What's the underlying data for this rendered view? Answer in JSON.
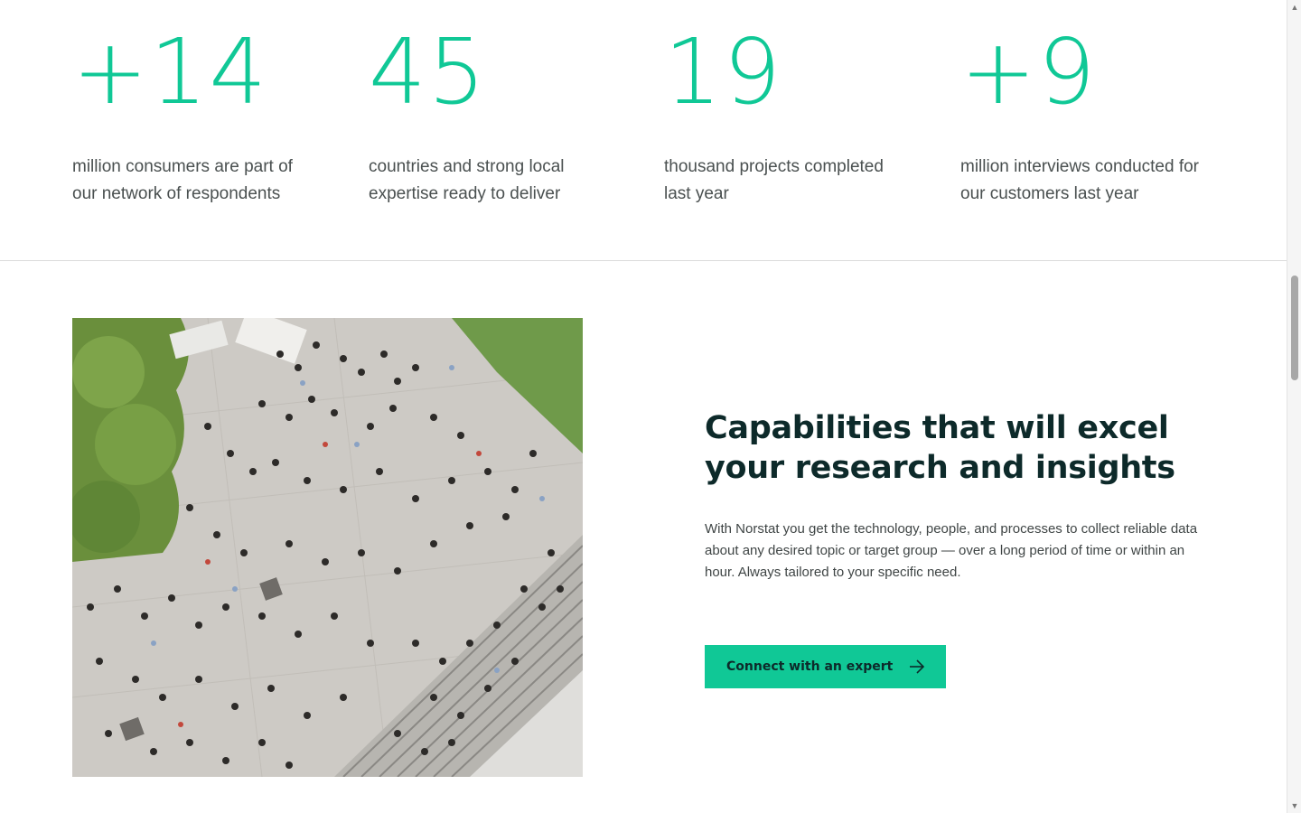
{
  "stats": [
    {
      "number": "+14",
      "text": "million consumers are part of our network of respondents"
    },
    {
      "number": "45",
      "text": "countries and strong local expertise ready to deliver"
    },
    {
      "number": "19",
      "text": "thousand projects completed last year"
    },
    {
      "number": "+9",
      "text": "million interviews conducted for our customers last year"
    }
  ],
  "capabilities": {
    "title": "Capabilities that will excel your research and insights",
    "body": "With Norstat you get the technology, people, and processes to collect reliable data about any desired topic or target group — over a long period of time or within an hour. Always tailored to your specific need.",
    "cta_label": "Connect with an expert"
  },
  "icons": {
    "cta_arrow": "arrow-right-icon",
    "scroll_up": "scroll-up-arrow",
    "scroll_down": "scroll-down-arrow"
  },
  "colors": {
    "accent": "#10c896",
    "heading": "#0d2a2a",
    "text": "#4a5050",
    "divider": "#dcdcdc"
  }
}
